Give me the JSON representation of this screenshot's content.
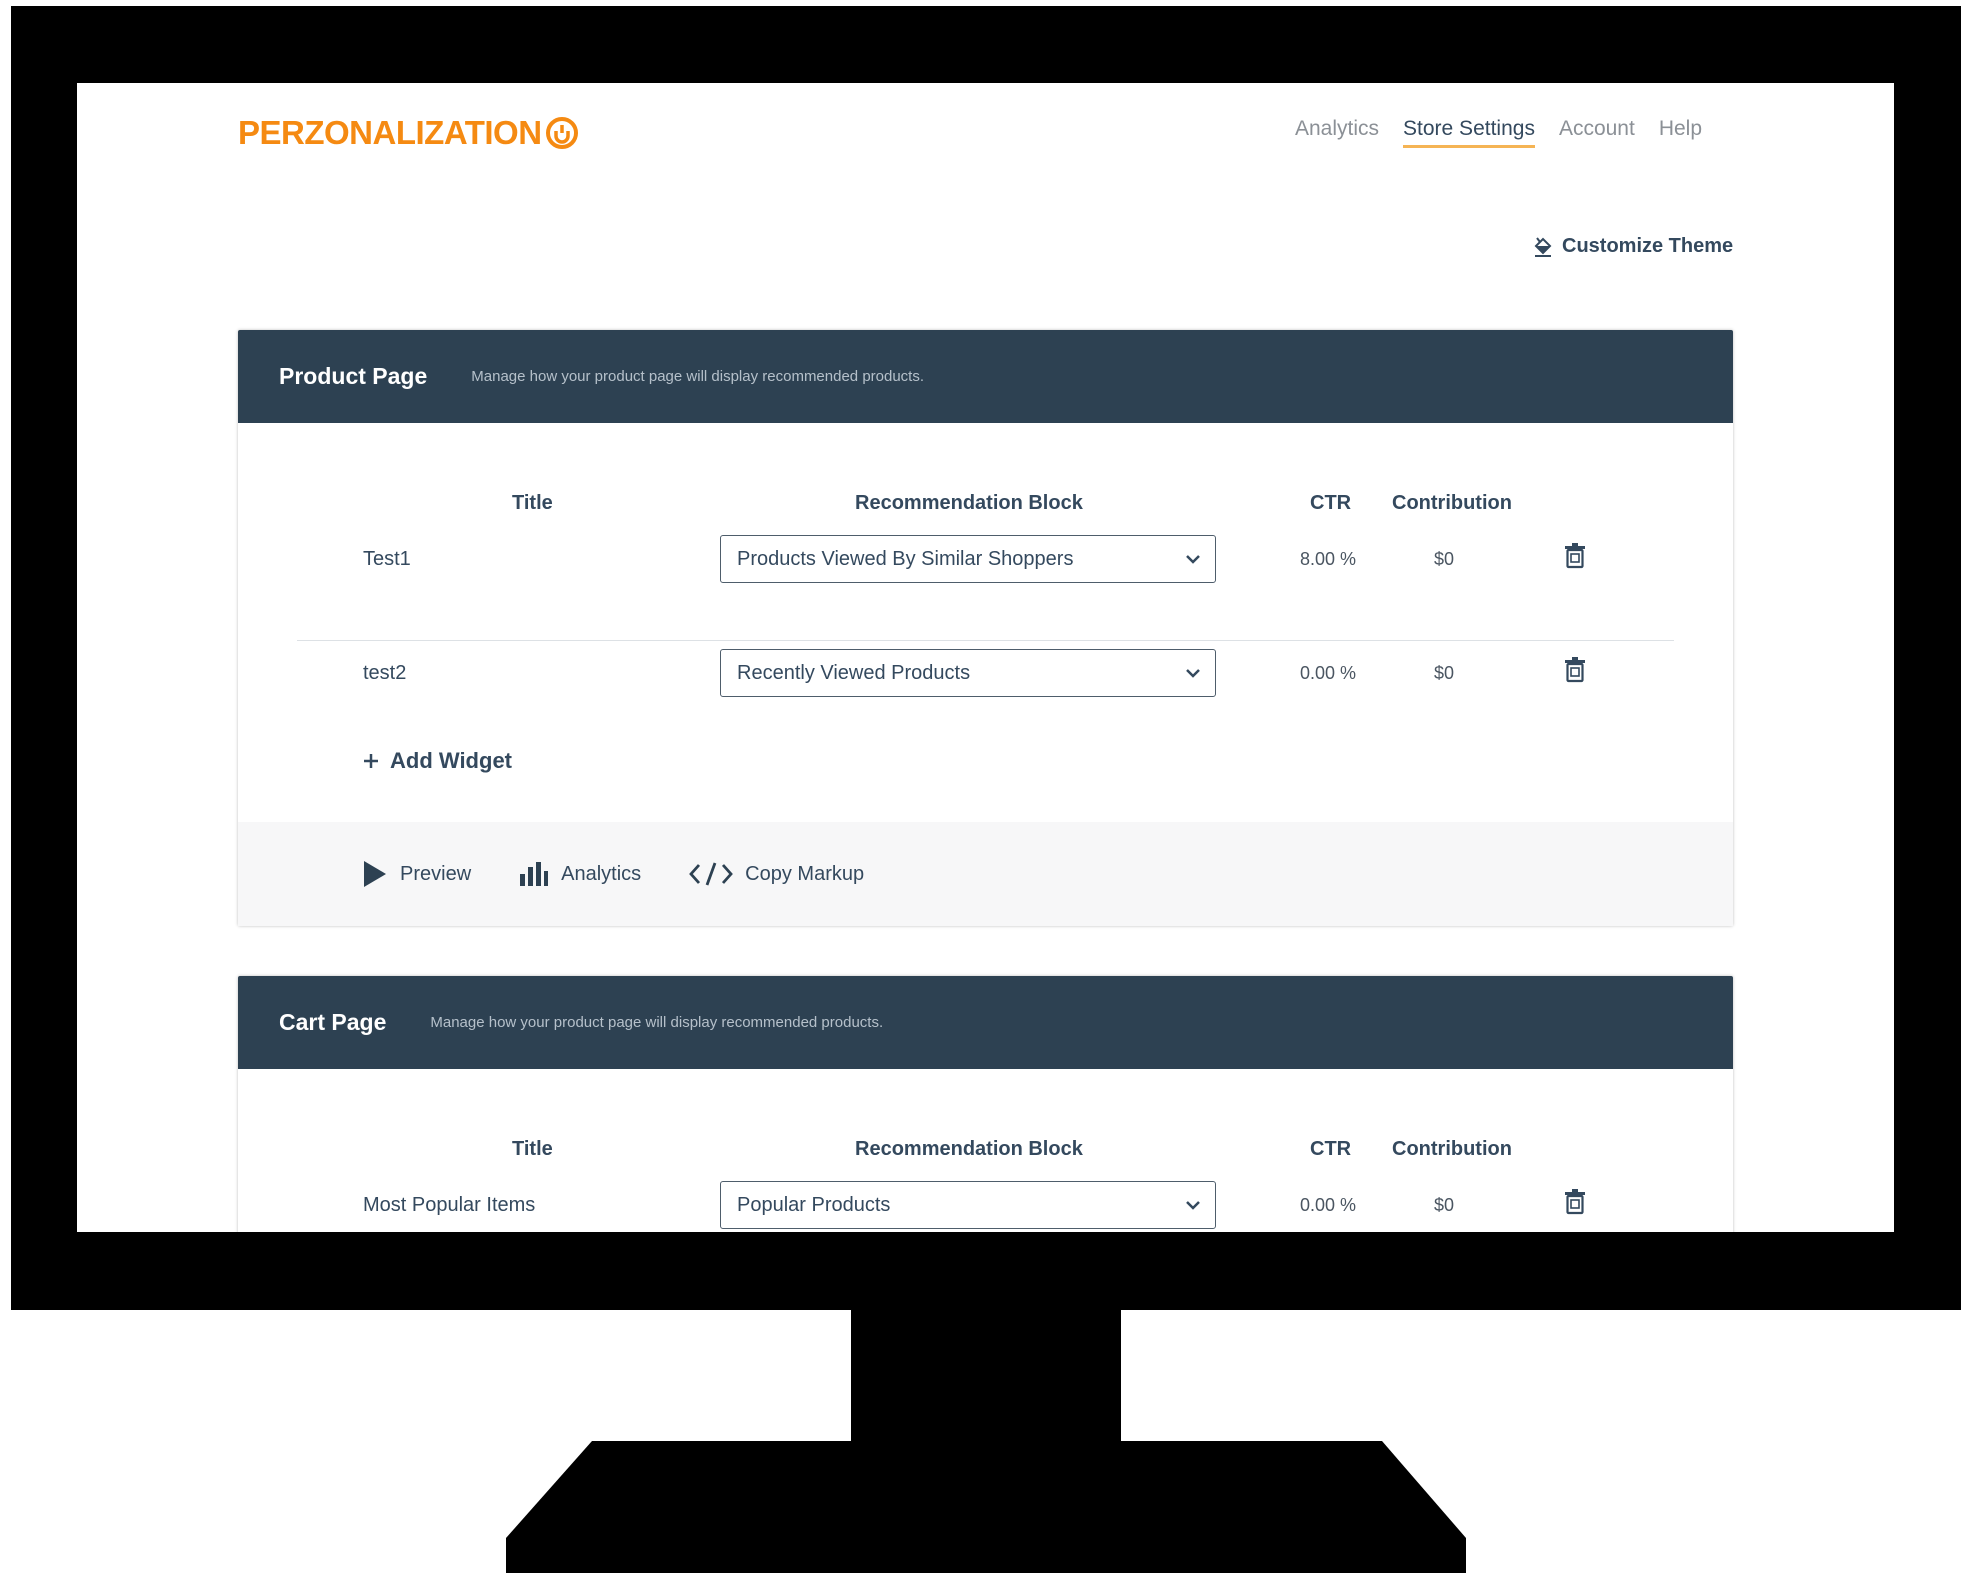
{
  "brand": {
    "logo_text": "PERZONALIZATION",
    "accent_color": "#f58a12"
  },
  "nav": {
    "items": [
      {
        "label": "Analytics",
        "active": false
      },
      {
        "label": "Store Settings",
        "active": true
      },
      {
        "label": "Account",
        "active": false
      },
      {
        "label": "Help",
        "active": false
      }
    ]
  },
  "customize_theme": {
    "label": "Customize Theme",
    "icon": "paint-bucket-icon"
  },
  "product_page": {
    "title": "Product Page",
    "description": "Manage how your product page will display recommended products.",
    "columns": {
      "title": "Title",
      "block": "Recommendation Block",
      "ctr": "CTR",
      "contribution": "Contribution"
    },
    "rows": [
      {
        "title": "Test1",
        "block": "Products Viewed By Similar Shoppers",
        "ctr": "8.00 %",
        "contribution": "$0"
      },
      {
        "title": "test2",
        "block": "Recently Viewed Products",
        "ctr": "0.00 %",
        "contribution": "$0"
      }
    ],
    "add_widget": "Add Widget",
    "footer": {
      "preview": "Preview",
      "analytics": "Analytics",
      "copy_markup": "Copy Markup"
    }
  },
  "cart_page": {
    "title": "Cart Page",
    "description": "Manage how your product page will display recommended products.",
    "columns": {
      "title": "Title",
      "block": "Recommendation Block",
      "ctr": "CTR",
      "contribution": "Contribution"
    },
    "rows": [
      {
        "title": "Most Popular Items",
        "block": "Popular Products",
        "ctr": "0.00 %",
        "contribution": "$0"
      }
    ]
  },
  "colors": {
    "header_bg": "#2d4152",
    "active_underline": "#f5b454",
    "text_dark": "#34495e"
  }
}
